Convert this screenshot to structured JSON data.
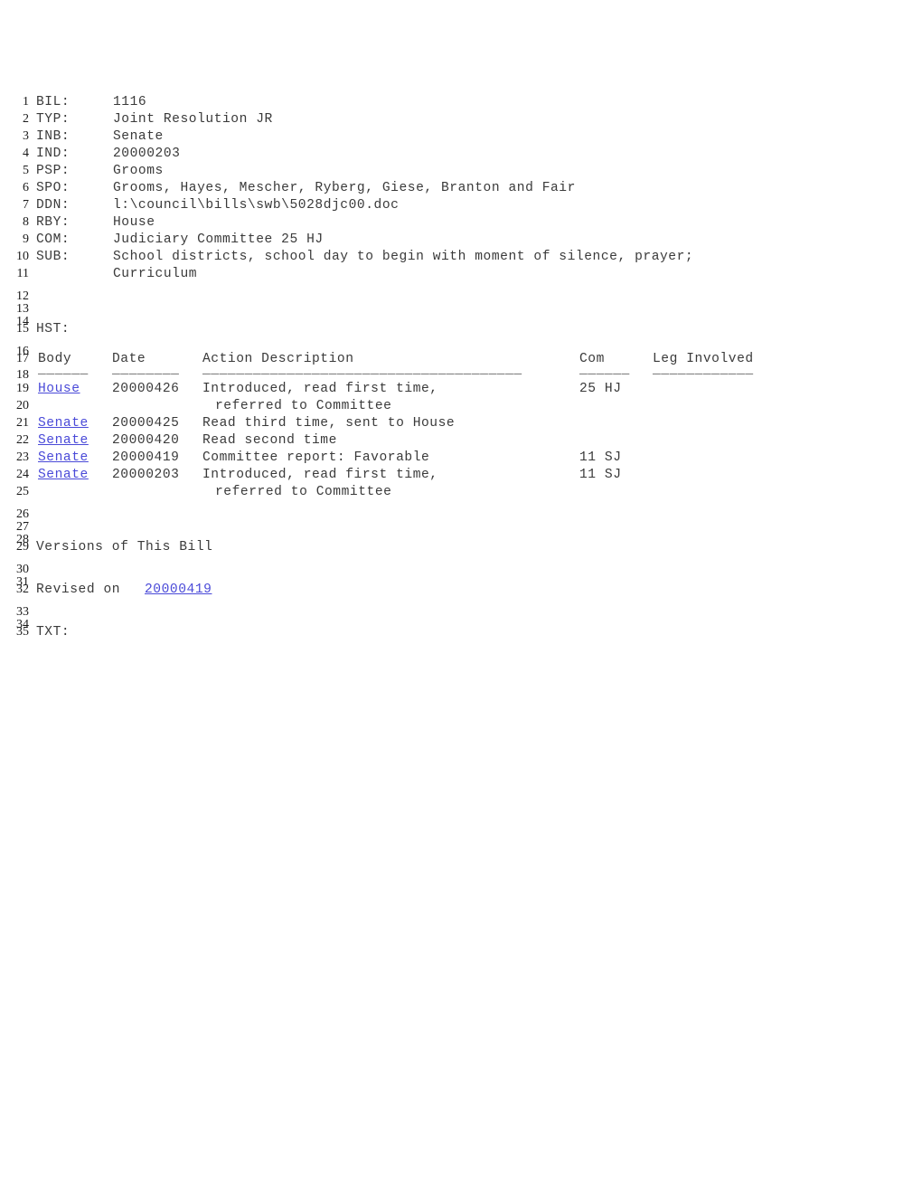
{
  "document": {
    "line_numbers": [
      1,
      2,
      3,
      4,
      5,
      6,
      7,
      8,
      9,
      10,
      11,
      12,
      13,
      14,
      15,
      16,
      17,
      18,
      19,
      20,
      21,
      22,
      23,
      24,
      25,
      26,
      27,
      28,
      29,
      30,
      31,
      32,
      33,
      34,
      35
    ],
    "link_color": "#4a4ad8",
    "text_color": "#3a3a3a"
  },
  "fields": [
    {
      "label": "BIL:",
      "value": "1116"
    },
    {
      "label": "TYP:",
      "value": "Joint Resolution JR"
    },
    {
      "label": "INB:",
      "value": "Senate"
    },
    {
      "label": "IND:",
      "value": "20000203"
    },
    {
      "label": "PSP:",
      "value": "Grooms"
    },
    {
      "label": "SPO:",
      "value": "Grooms, Hayes, Mescher, Ryberg, Giese, Branton and Fair"
    },
    {
      "label": "DDN:",
      "value": "l:\\council\\bills\\swb\\5028djc00.doc"
    },
    {
      "label": "RBY:",
      "value": "House"
    },
    {
      "label": "COM:",
      "value": "Judiciary Committee 25 HJ"
    },
    {
      "label": "SUB:",
      "value": "School districts, school day to begin with moment of silence, prayer;"
    },
    {
      "label": "",
      "value": "Curriculum"
    }
  ],
  "history": {
    "section_label": "HST:",
    "headers": {
      "body": "Body",
      "date": "Date",
      "action": "Action Description",
      "com": "Com",
      "leg": "Leg Involved"
    },
    "rules": {
      "body": "______",
      "date": "________",
      "action": "______________________________________",
      "com": "______",
      "leg": "____________"
    },
    "rows": [
      {
        "body": "House",
        "date": "20000426",
        "action": "Introduced, read first time,",
        "action2": "referred to Committee",
        "com": "25 HJ",
        "leg": ""
      },
      {
        "body": "Senate",
        "date": "20000425",
        "action": "Read third time, sent to House",
        "action2": "",
        "com": "",
        "leg": ""
      },
      {
        "body": "Senate",
        "date": "20000420",
        "action": "Read second time",
        "action2": "",
        "com": "",
        "leg": ""
      },
      {
        "body": "Senate",
        "date": "20000419",
        "action": "Committee report: Favorable",
        "action2": "",
        "com": "11 SJ",
        "leg": ""
      },
      {
        "body": "Senate",
        "date": "20000203",
        "action": "Introduced, read first time,",
        "action2": "referred to Committee",
        "com": "11 SJ",
        "leg": ""
      }
    ]
  },
  "versions": {
    "heading": "Versions of This Bill",
    "revised_prefix": "Revised on ",
    "revised_date": "20000419"
  },
  "text_section": {
    "label": "TXT:"
  }
}
